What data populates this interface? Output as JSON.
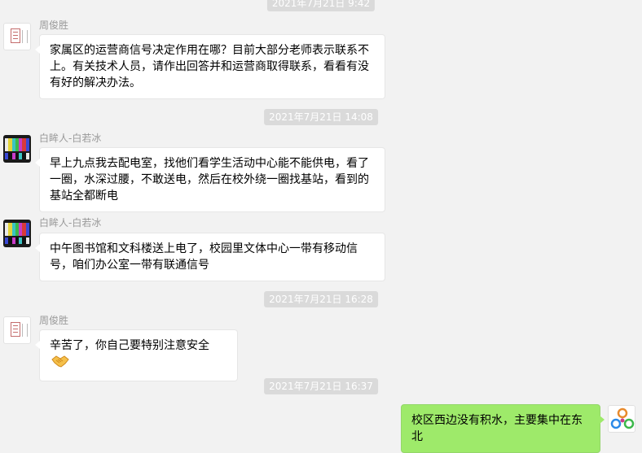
{
  "timestamps": [
    "2021年7月21日 9:42",
    "2021年7月21日 14:08",
    "2021年7月21日 16:28",
    "2021年7月21日 16:37"
  ],
  "messages": [
    {
      "sender": "周俊胜",
      "text": "家属区的运营商信号决定作用在哪？目前大部分老师表示联系不上。有关技术人员，请作出回答并和运营商取得联系，看看有没有好的解决办法。"
    },
    {
      "sender": "白眸人-白若冰",
      "text": "早上九点我去配电室，找他们看学生活动中心能不能供电，看了一圈，水深过腰，不敢送电，然后在校外绕一圈找基站，看到的基站全都断电"
    },
    {
      "sender": "白眸人-白若冰",
      "text": "中午图书馆和文科楼送上电了，校园里文体中心一带有移动信号，咱们办公室一带有联通信号"
    },
    {
      "sender": "周俊胜",
      "text": "辛苦了，你自己要特别注意安全",
      "emoji": "handshake-emoji"
    },
    {
      "sender": "",
      "text": "校区西边没有积水，主要集中在东北"
    }
  ],
  "colors": {
    "background": "#f2f2f2",
    "timestamp_bg": "#dadada",
    "self_bubble": "#9eea6a",
    "other_bubble": "#ffffff"
  }
}
